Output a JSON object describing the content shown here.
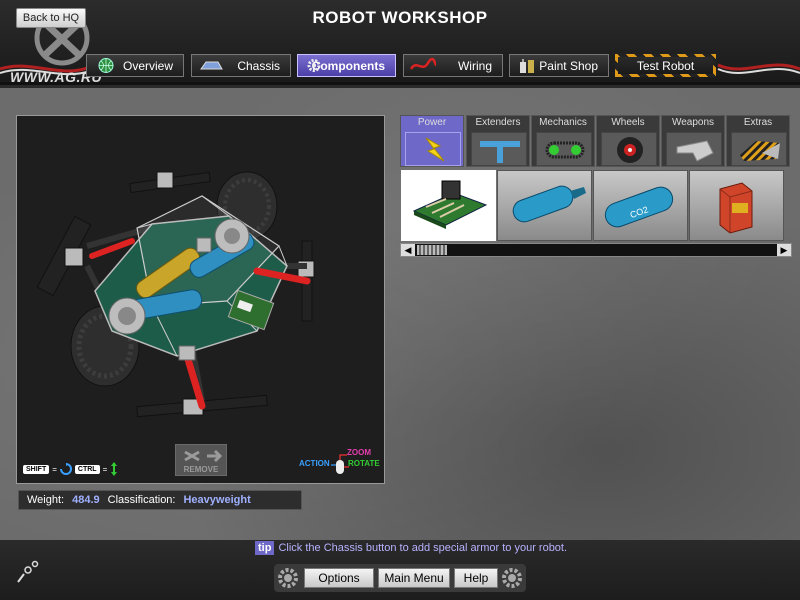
{
  "header": {
    "title": "ROBOT WORKSHOP",
    "back_label": "Back to HQ",
    "watermark": "WWW.AG.RU"
  },
  "nav": {
    "tabs": [
      {
        "label": "Overview",
        "icon": "globe-icon"
      },
      {
        "label": "Chassis",
        "icon": "chassis-icon"
      },
      {
        "label": "Components",
        "icon": "gear-icon",
        "active": true
      },
      {
        "label": "Wiring",
        "icon": "wire-icon"
      },
      {
        "label": "Paint Shop",
        "icon": "paint-cans-icon"
      },
      {
        "label": "Test Robot",
        "icon": "hazard-stripes"
      }
    ]
  },
  "viewport": {
    "shift_key": "SHIFT",
    "ctrl_key": "CTRL",
    "shift_symbol": "=",
    "ctrl_symbol": "=",
    "remove_label": "REMOVE",
    "mouse_action": "ACTION",
    "mouse_zoom": "ZOOM",
    "mouse_rotate": "ROTATE"
  },
  "stats": {
    "weight_label": "Weight:",
    "weight_value": "484.9",
    "class_label": "Classification:",
    "class_value": "Heavyweight"
  },
  "parts": {
    "categories": [
      {
        "label": "Power",
        "icon": "lightning-icon",
        "active": true
      },
      {
        "label": "Extenders",
        "icon": "extender-icon"
      },
      {
        "label": "Mechanics",
        "icon": "chain-gear-icon"
      },
      {
        "label": "Wheels",
        "icon": "wheel-icon"
      },
      {
        "label": "Weapons",
        "icon": "blade-icon"
      },
      {
        "label": "Extras",
        "icon": "armor-icon"
      }
    ],
    "items": [
      {
        "name": "circuit-board",
        "selected": true
      },
      {
        "name": "battery-cylinder"
      },
      {
        "name": "co2-tank",
        "print": "CO2"
      },
      {
        "name": "fuel-box"
      }
    ]
  },
  "footer": {
    "tip_badge": "tip",
    "tip_text": "Click the Chassis button to add special armor to your robot.",
    "options_label": "Options",
    "main_menu_label": "Main Menu",
    "help_label": "Help"
  },
  "colors": {
    "accent": "#6e68c8",
    "tip_text": "#b6b2ff",
    "info_value": "#9fb0ff",
    "hazard": "#e09a1a"
  }
}
